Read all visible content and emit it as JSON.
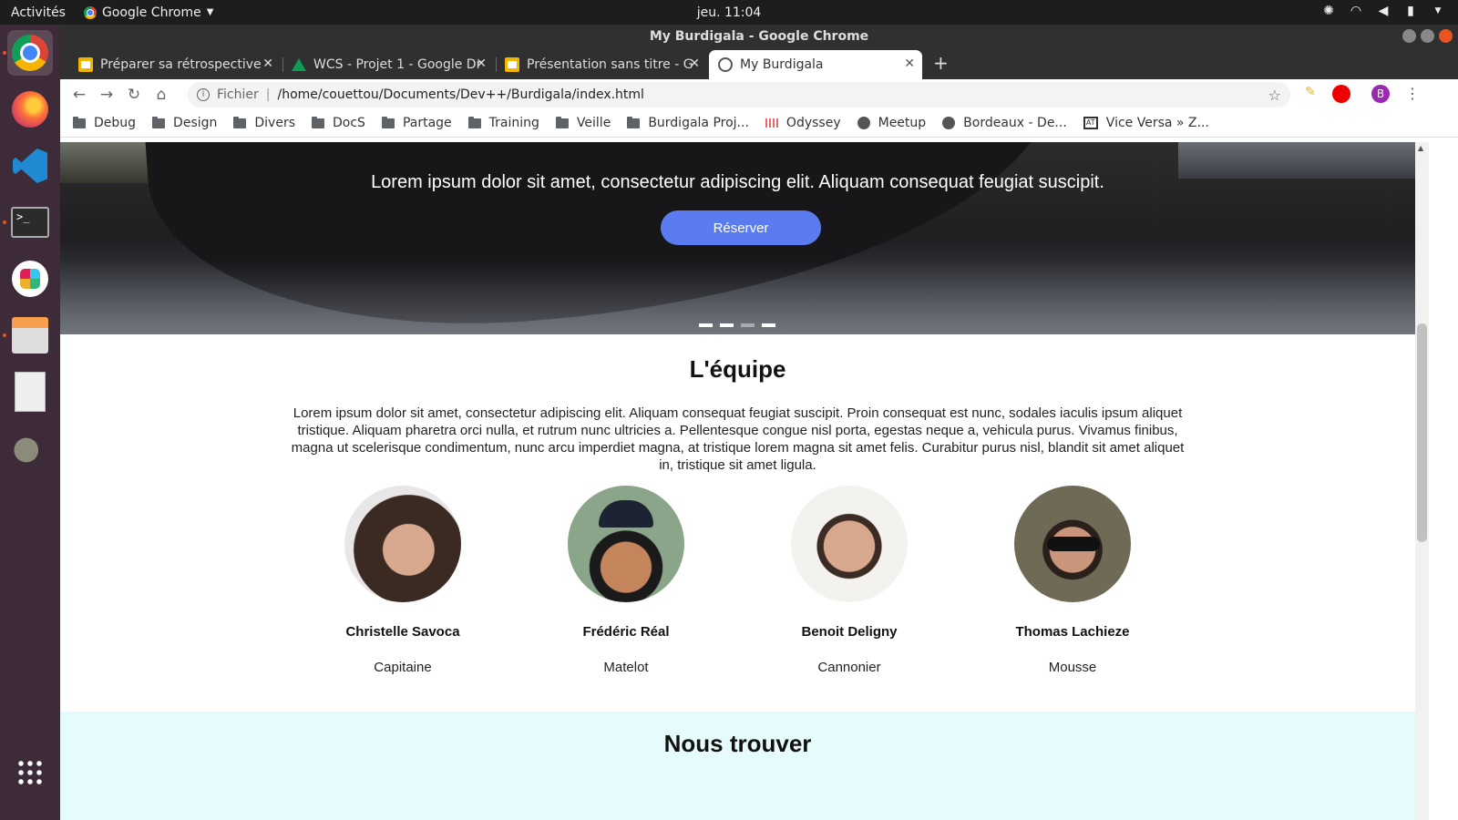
{
  "os": {
    "activities": "Activités",
    "app_name": "Google Chrome",
    "clock": "jeu. 11:04"
  },
  "window": {
    "title": "My Burdigala - Google Chrome"
  },
  "tabs": [
    {
      "label": "Préparer sa rétrospective",
      "icon": "slides-icon"
    },
    {
      "label": "WCS - Projet 1 - Google Dr",
      "icon": "drive-icon"
    },
    {
      "label": "Présentation sans titre - G",
      "icon": "slides-icon"
    },
    {
      "label": "My Burdigala",
      "icon": "globe-icon",
      "active": true
    }
  ],
  "omnibox": {
    "scheme": "Fichier",
    "url": "/home/couettou/Documents/Dev++/Burdigala/index.html",
    "avatar_letter": "B"
  },
  "bookmarks": [
    {
      "label": "Debug",
      "icon": "folder"
    },
    {
      "label": "Design",
      "icon": "folder"
    },
    {
      "label": "Divers",
      "icon": "folder"
    },
    {
      "label": "DocS",
      "icon": "folder"
    },
    {
      "label": "Partage",
      "icon": "folder"
    },
    {
      "label": "Training",
      "icon": "folder"
    },
    {
      "label": "Veille",
      "icon": "folder"
    },
    {
      "label": "Burdigala Proj...",
      "icon": "folder"
    },
    {
      "label": "Odyssey",
      "icon": "odyssey"
    },
    {
      "label": "Meetup",
      "icon": "globe"
    },
    {
      "label": "Bordeaux - De...",
      "icon": "globe"
    },
    {
      "label": "Vice Versa » Z...",
      "icon": "viceversa"
    }
  ],
  "hero": {
    "text": "Lorem ipsum dolor sit amet, consectetur adipiscing elit. Aliquam consequat feugiat suscipit.",
    "button": "Réserver",
    "slides": 4,
    "active_slide": 3
  },
  "team": {
    "title": "L'équipe",
    "description": "Lorem ipsum dolor sit amet, consectetur adipiscing elit. Aliquam consequat feugiat suscipit. Proin consequat est nunc, sodales iaculis ipsum aliquet tristique. Aliquam pharetra orci nulla, et rutrum nunc ultricies a. Pellentesque congue nisl porta, egestas neque a, vehicula purus. Vivamus finibus, magna ut scelerisque condimentum, nunc arcu imperdiet magna, at tristique lorem magna sit amet felis. Curabitur purus nisl, blandit sit amet aliquet in, tristique sit amet ligula.",
    "members": [
      {
        "name": "Christelle Savoca",
        "role": "Capitaine"
      },
      {
        "name": "Frédéric Réal",
        "role": "Matelot"
      },
      {
        "name": "Benoit Deligny",
        "role": "Cannonier"
      },
      {
        "name": "Thomas Lachieze",
        "role": "Mousse"
      }
    ]
  },
  "find": {
    "title": "Nous trouver"
  },
  "colors": {
    "button": "#5b7cf0",
    "find_bg": "#e6fbfb",
    "dock_bg": "#3d2b39"
  }
}
